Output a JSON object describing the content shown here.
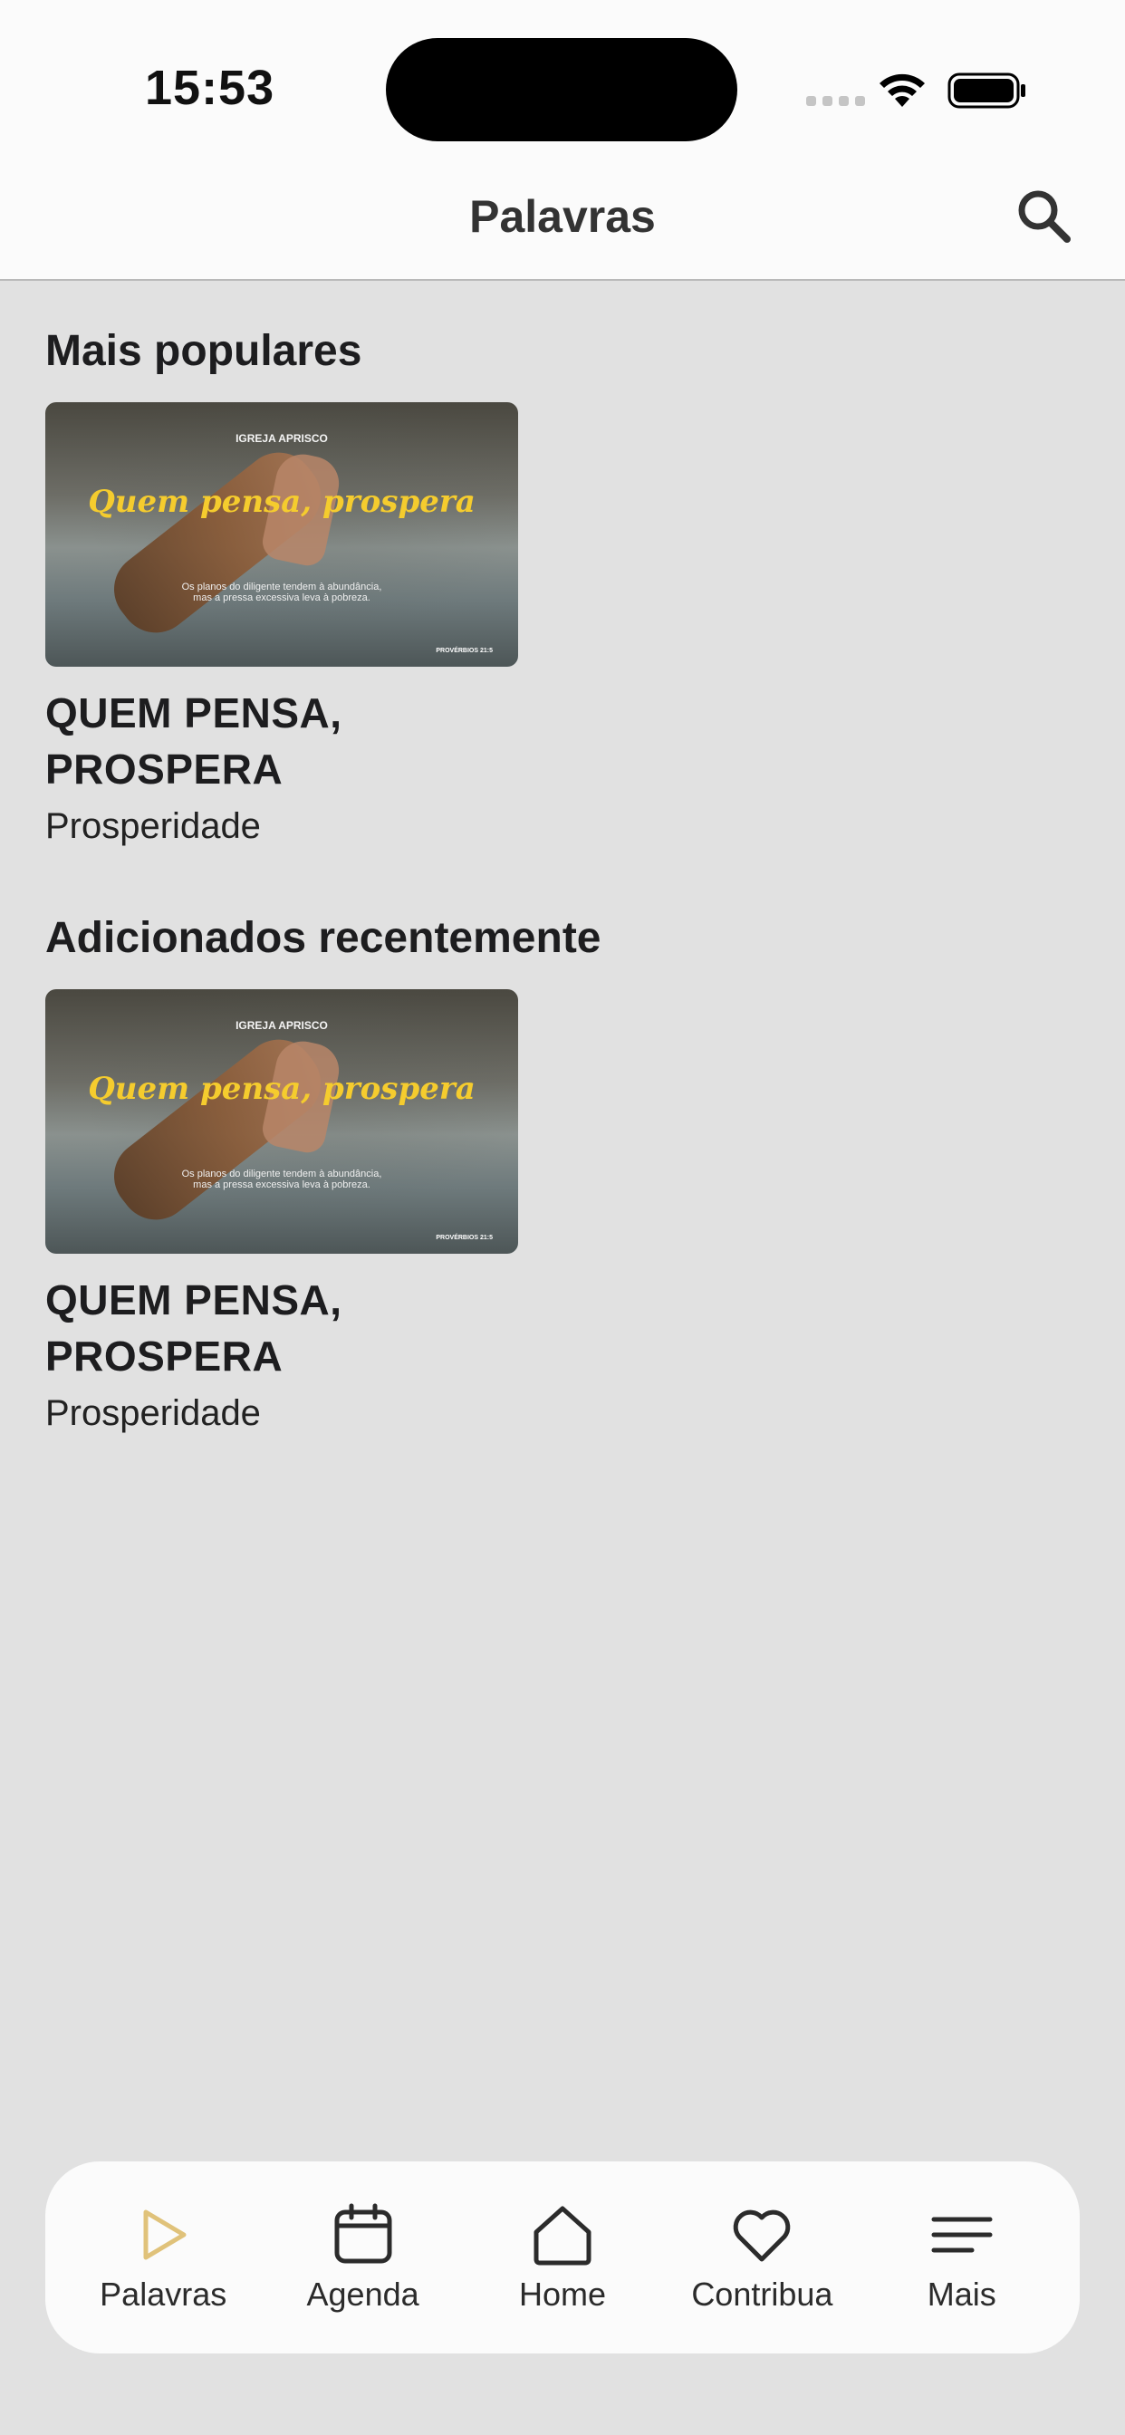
{
  "status_bar": {
    "time": "15:53"
  },
  "header": {
    "title": "Palavras",
    "search_icon": "search-icon"
  },
  "sections": [
    {
      "title": "Mais populares",
      "items": [
        {
          "thumbnail": {
            "brand": "IGREJA APRISCO",
            "headline": "Quem pensa, prospera",
            "verse": "Os planos do diligente tendem à abundância, mas a pressa excessiva leva à pobreza.",
            "reference": "PROVÉRBIOS 21:5"
          },
          "title": "QUEM PENSA, PROSPERA",
          "category": "Prosperidade"
        }
      ]
    },
    {
      "title": "Adicionados recentemente",
      "items": [
        {
          "thumbnail": {
            "brand": "IGREJA APRISCO",
            "headline": "Quem pensa, prospera",
            "verse": "Os planos do diligente tendem à abundância, mas a pressa excessiva leva à pobreza.",
            "reference": "PROVÉRBIOS 21:5"
          },
          "title": "QUEM PENSA, PROSPERA",
          "category": "Prosperidade"
        }
      ]
    }
  ],
  "tab_bar": {
    "active_color": "#e0c27a",
    "tabs": [
      {
        "label": "Palavras",
        "icon": "play-icon",
        "active": true
      },
      {
        "label": "Agenda",
        "icon": "calendar-icon",
        "active": false
      },
      {
        "label": "Home",
        "icon": "home-icon",
        "active": false
      },
      {
        "label": "Contribua",
        "icon": "heart-icon",
        "active": false
      },
      {
        "label": "Mais",
        "icon": "menu-icon",
        "active": false
      }
    ]
  }
}
